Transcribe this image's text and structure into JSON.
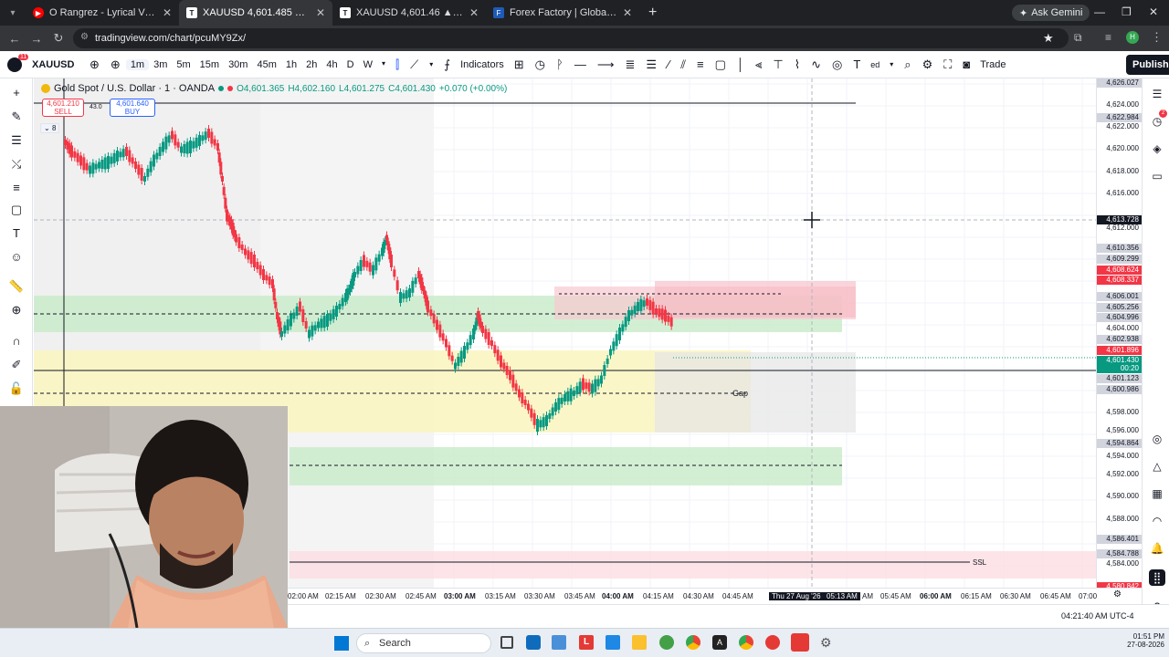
{
  "browser": {
    "tabs": [
      {
        "title": "O Rangrez - Lyrical Video | Bha",
        "icon": "youtube-icon",
        "color": "#ff0000",
        "active": false
      },
      {
        "title": "XAUUSD 4,601.485 ▲ +0.15% U",
        "icon": "tradingview-icon",
        "color": "#131722",
        "active": true
      },
      {
        "title": "XAUUSD 4,601.46 ▲ +0.15% U",
        "icon": "tradingview-icon",
        "color": "#131722",
        "active": false
      },
      {
        "title": "Forex Factory | Global markets f",
        "icon": "forexfactory-icon",
        "color": "#1e5bb8",
        "active": false
      }
    ],
    "new_tab": "+",
    "gemini": "Ask Gemini",
    "url": "tradingview.com/chart/pcuMY9Zx/"
  },
  "toolbar": {
    "badge": "11",
    "symbol": "XAUUSD",
    "timeframes": [
      "1m",
      "3m",
      "5m",
      "15m",
      "30m",
      "45m",
      "1h",
      "2h",
      "4h",
      "D",
      "W"
    ],
    "indicators": "Indicators",
    "partial_label": "ed",
    "trade": "Trade",
    "publish": "Publish"
  },
  "legend": {
    "title": "Gold Spot / U.S. Dollar · 1 · OANDA",
    "o": "O4,601.365",
    "h": "H4,602.160",
    "l": "L4,601.275",
    "c": "C4,601.430",
    "change": "+0.070 (+0.00%)",
    "sell_price": "4,601.210",
    "sell_label": "SELL",
    "spread": "43.0",
    "buy_price": "4,601.640",
    "buy_label": "BUY",
    "collapse_count": "8"
  },
  "annotations": {
    "gap": "Gap",
    "ssl": "SSL"
  },
  "price_axis": [
    {
      "v": "4,626.027",
      "bg": "#d1d4dc",
      "fg": "#131722"
    },
    {
      "v": "4,624.000",
      "bg": "",
      "fg": "#131722"
    },
    {
      "v": "4,622.984",
      "bg": "#d1d4dc",
      "fg": "#131722"
    },
    {
      "v": "4,622.000",
      "bg": "",
      "fg": "#131722"
    },
    {
      "v": "4,620.000",
      "bg": "",
      "fg": "#131722"
    },
    {
      "v": "4,618.000",
      "bg": "",
      "fg": "#131722"
    },
    {
      "v": "4,616.000",
      "bg": "",
      "fg": "#131722"
    },
    {
      "v": "4,613.728",
      "bg": "#131722",
      "fg": "#ffffff"
    },
    {
      "v": "4,612.000",
      "bg": "",
      "fg": "#131722"
    },
    {
      "v": "4,610.356",
      "bg": "#d1d4dc",
      "fg": "#131722"
    },
    {
      "v": "4,609.299",
      "bg": "#d1d4dc",
      "fg": "#131722"
    },
    {
      "v": "4,608.624",
      "bg": "#f23645",
      "fg": "#ffffff"
    },
    {
      "v": "4,608.337",
      "bg": "#f23645",
      "fg": "#ffffff"
    },
    {
      "v": "4,606.001",
      "bg": "#d1d4dc",
      "fg": "#131722"
    },
    {
      "v": "4,605.256",
      "bg": "#d1d4dc",
      "fg": "#131722"
    },
    {
      "v": "4,604.996",
      "bg": "#d1d4dc",
      "fg": "#131722"
    },
    {
      "v": "4,604.000",
      "bg": "",
      "fg": "#131722"
    },
    {
      "v": "4,602.938",
      "bg": "#d1d4dc",
      "fg": "#131722"
    },
    {
      "v": "4,601.896",
      "bg": "#f23645",
      "fg": "#ffffff"
    },
    {
      "v": "4,601.430",
      "bg": "#089981",
      "fg": "#ffffff"
    },
    {
      "v": "00:20",
      "bg": "#089981",
      "fg": "#ffffff"
    },
    {
      "v": "4,601.123",
      "bg": "#d1d4dc",
      "fg": "#131722"
    },
    {
      "v": "4,600.986",
      "bg": "#d1d4dc",
      "fg": "#131722"
    },
    {
      "v": "4,598.000",
      "bg": "",
      "fg": "#131722"
    },
    {
      "v": "4,596.000",
      "bg": "",
      "fg": "#131722"
    },
    {
      "v": "4,594.864",
      "bg": "#d1d4dc",
      "fg": "#131722"
    },
    {
      "v": "4,594.000",
      "bg": "",
      "fg": "#131722"
    },
    {
      "v": "4,592.000",
      "bg": "",
      "fg": "#131722"
    },
    {
      "v": "4,590.000",
      "bg": "",
      "fg": "#131722"
    },
    {
      "v": "4,588.000",
      "bg": "",
      "fg": "#131722"
    },
    {
      "v": "4,586.401",
      "bg": "#d1d4dc",
      "fg": "#131722"
    },
    {
      "v": "4,584.788",
      "bg": "#d1d4dc",
      "fg": "#131722"
    },
    {
      "v": "4,584.000",
      "bg": "",
      "fg": "#131722"
    },
    {
      "v": "4,580.842",
      "bg": "#f23645",
      "fg": "#ffffff"
    }
  ],
  "time_axis": [
    "02:00 AM",
    "02:15 AM",
    "02:30 AM",
    "02:45 AM",
    "03:00 AM",
    "03:15 AM",
    "03:30 AM",
    "03:45 AM",
    "04:00 AM",
    "04:15 AM",
    "04:30 AM",
    "04:45 AM",
    "Thu 27 Aug '26",
    "05:13 AM",
    "AM",
    "05:45 AM",
    "06:00 AM",
    "06:15 AM",
    "06:30 AM",
    "06:45 AM",
    "07:00"
  ],
  "status": {
    "clock": "04:21:40 AM UTC-4"
  },
  "taskbar": {
    "search": "Search",
    "time": "01:51 PM",
    "date": "27-08-2026"
  }
}
